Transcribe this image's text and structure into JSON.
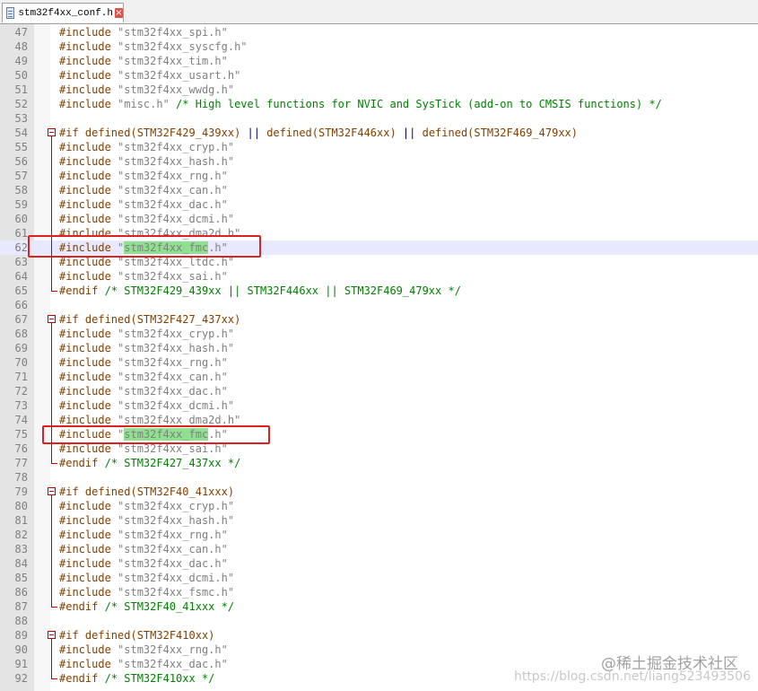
{
  "tab": {
    "filename": "stm32f4xx_conf.h",
    "icon": "header-file-icon",
    "close_symbol": "×"
  },
  "lines": [
    {
      "n": "47",
      "segs": [
        {
          "c": "pp",
          "t": "#include "
        },
        {
          "c": "str",
          "t": "\"stm32f4xx_spi.h\""
        }
      ]
    },
    {
      "n": "48",
      "segs": [
        {
          "c": "pp",
          "t": "#include "
        },
        {
          "c": "str",
          "t": "\"stm32f4xx_syscfg.h\""
        }
      ]
    },
    {
      "n": "49",
      "segs": [
        {
          "c": "pp",
          "t": "#include "
        },
        {
          "c": "str",
          "t": "\"stm32f4xx_tim.h\""
        }
      ]
    },
    {
      "n": "50",
      "segs": [
        {
          "c": "pp",
          "t": "#include "
        },
        {
          "c": "str",
          "t": "\"stm32f4xx_usart.h\""
        }
      ]
    },
    {
      "n": "51",
      "segs": [
        {
          "c": "pp",
          "t": "#include "
        },
        {
          "c": "str",
          "t": "\"stm32f4xx_wwdg.h\""
        }
      ]
    },
    {
      "n": "52",
      "segs": [
        {
          "c": "pp",
          "t": "#include "
        },
        {
          "c": "str",
          "t": "\"misc.h\""
        },
        {
          "c": "cmt",
          "t": " /* High level functions for NVIC and SysTick (add-on to CMSIS functions) */"
        }
      ]
    },
    {
      "n": "53",
      "segs": []
    },
    {
      "n": "54",
      "fold": "start",
      "segs": [
        {
          "c": "pp",
          "t": "#if defined(STM32F429_439xx) "
        },
        {
          "c": "op",
          "t": "||"
        },
        {
          "c": "pp",
          "t": " defined(STM32F446xx) "
        },
        {
          "c": "op",
          "t": "||"
        },
        {
          "c": "pp",
          "t": " defined(STM32F469_479xx)"
        }
      ]
    },
    {
      "n": "55",
      "segs": [
        {
          "c": "pp",
          "t": "#include "
        },
        {
          "c": "str",
          "t": "\"stm32f4xx_cryp.h\""
        }
      ]
    },
    {
      "n": "56",
      "segs": [
        {
          "c": "pp",
          "t": "#include "
        },
        {
          "c": "str",
          "t": "\"stm32f4xx_hash.h\""
        }
      ]
    },
    {
      "n": "57",
      "segs": [
        {
          "c": "pp",
          "t": "#include "
        },
        {
          "c": "str",
          "t": "\"stm32f4xx_rng.h\""
        }
      ]
    },
    {
      "n": "58",
      "segs": [
        {
          "c": "pp",
          "t": "#include "
        },
        {
          "c": "str",
          "t": "\"stm32f4xx_can.h\""
        }
      ]
    },
    {
      "n": "59",
      "segs": [
        {
          "c": "pp",
          "t": "#include "
        },
        {
          "c": "str",
          "t": "\"stm32f4xx_dac.h\""
        }
      ]
    },
    {
      "n": "60",
      "segs": [
        {
          "c": "pp",
          "t": "#include "
        },
        {
          "c": "str",
          "t": "\"stm32f4xx_dcmi.h\""
        }
      ]
    },
    {
      "n": "61",
      "segs": [
        {
          "c": "pp",
          "t": "#include "
        },
        {
          "c": "str",
          "t": "\"stm32f4xx_dma2d.h\""
        }
      ]
    },
    {
      "n": "62",
      "current": true,
      "segs": [
        {
          "c": "pp",
          "t": "#include "
        },
        {
          "c": "str",
          "t": "\""
        },
        {
          "c": "str hl",
          "t": "stm32f4xx_fmc"
        },
        {
          "c": "str",
          "t": ".h\""
        }
      ]
    },
    {
      "n": "63",
      "segs": [
        {
          "c": "pp",
          "t": "#include "
        },
        {
          "c": "str",
          "t": "\"stm32f4xx_ltdc.h\""
        }
      ]
    },
    {
      "n": "64",
      "segs": [
        {
          "c": "pp",
          "t": "#include "
        },
        {
          "c": "str",
          "t": "\"stm32f4xx_sai.h\""
        }
      ]
    },
    {
      "n": "65",
      "fold": "end",
      "segs": [
        {
          "c": "pp",
          "t": "#endif "
        },
        {
          "c": "cmt",
          "t": "/* STM32F429_439xx || STM32F446xx || STM32F469_479xx */"
        }
      ]
    },
    {
      "n": "66",
      "segs": []
    },
    {
      "n": "67",
      "fold": "start",
      "segs": [
        {
          "c": "pp",
          "t": "#if defined(STM32F427_437xx)"
        }
      ]
    },
    {
      "n": "68",
      "segs": [
        {
          "c": "pp",
          "t": "#include "
        },
        {
          "c": "str",
          "t": "\"stm32f4xx_cryp.h\""
        }
      ]
    },
    {
      "n": "69",
      "segs": [
        {
          "c": "pp",
          "t": "#include "
        },
        {
          "c": "str",
          "t": "\"stm32f4xx_hash.h\""
        }
      ]
    },
    {
      "n": "70",
      "segs": [
        {
          "c": "pp",
          "t": "#include "
        },
        {
          "c": "str",
          "t": "\"stm32f4xx_rng.h\""
        }
      ]
    },
    {
      "n": "71",
      "segs": [
        {
          "c": "pp",
          "t": "#include "
        },
        {
          "c": "str",
          "t": "\"stm32f4xx_can.h\""
        }
      ]
    },
    {
      "n": "72",
      "segs": [
        {
          "c": "pp",
          "t": "#include "
        },
        {
          "c": "str",
          "t": "\"stm32f4xx_dac.h\""
        }
      ]
    },
    {
      "n": "73",
      "segs": [
        {
          "c": "pp",
          "t": "#include "
        },
        {
          "c": "str",
          "t": "\"stm32f4xx_dcmi.h\""
        }
      ]
    },
    {
      "n": "74",
      "segs": [
        {
          "c": "pp",
          "t": "#include "
        },
        {
          "c": "str",
          "t": "\"stm32f4xx_dma2d.h\""
        }
      ]
    },
    {
      "n": "75",
      "segs": [
        {
          "c": "pp",
          "t": "#include "
        },
        {
          "c": "str",
          "t": "\""
        },
        {
          "c": "str hl",
          "t": "stm32f4xx_fmc"
        },
        {
          "c": "str",
          "t": ".h\""
        }
      ]
    },
    {
      "n": "76",
      "segs": [
        {
          "c": "pp",
          "t": "#include "
        },
        {
          "c": "str",
          "t": "\"stm32f4xx_sai.h\""
        }
      ]
    },
    {
      "n": "77",
      "fold": "end",
      "segs": [
        {
          "c": "pp",
          "t": "#endif "
        },
        {
          "c": "cmt",
          "t": "/* STM32F427_437xx */"
        }
      ]
    },
    {
      "n": "78",
      "segs": []
    },
    {
      "n": "79",
      "fold": "start",
      "segs": [
        {
          "c": "pp",
          "t": "#if defined(STM32F40_41xxx)"
        }
      ]
    },
    {
      "n": "80",
      "segs": [
        {
          "c": "pp",
          "t": "#include "
        },
        {
          "c": "str",
          "t": "\"stm32f4xx_cryp.h\""
        }
      ]
    },
    {
      "n": "81",
      "segs": [
        {
          "c": "pp",
          "t": "#include "
        },
        {
          "c": "str",
          "t": "\"stm32f4xx_hash.h\""
        }
      ]
    },
    {
      "n": "82",
      "segs": [
        {
          "c": "pp",
          "t": "#include "
        },
        {
          "c": "str",
          "t": "\"stm32f4xx_rng.h\""
        }
      ]
    },
    {
      "n": "83",
      "segs": [
        {
          "c": "pp",
          "t": "#include "
        },
        {
          "c": "str",
          "t": "\"stm32f4xx_can.h\""
        }
      ]
    },
    {
      "n": "84",
      "segs": [
        {
          "c": "pp",
          "t": "#include "
        },
        {
          "c": "str",
          "t": "\"stm32f4xx_dac.h\""
        }
      ]
    },
    {
      "n": "85",
      "segs": [
        {
          "c": "pp",
          "t": "#include "
        },
        {
          "c": "str",
          "t": "\"stm32f4xx_dcmi.h\""
        }
      ]
    },
    {
      "n": "86",
      "segs": [
        {
          "c": "pp",
          "t": "#include "
        },
        {
          "c": "str",
          "t": "\"stm32f4xx_fsmc.h\""
        }
      ]
    },
    {
      "n": "87",
      "fold": "end",
      "segs": [
        {
          "c": "pp",
          "t": "#endif "
        },
        {
          "c": "cmt",
          "t": "/* STM32F40_41xxx */"
        }
      ]
    },
    {
      "n": "88",
      "segs": []
    },
    {
      "n": "89",
      "fold": "start",
      "segs": [
        {
          "c": "pp",
          "t": "#if defined(STM32F410xx)"
        }
      ]
    },
    {
      "n": "90",
      "segs": [
        {
          "c": "pp",
          "t": "#include "
        },
        {
          "c": "str",
          "t": "\"stm32f4xx_rng.h\""
        }
      ]
    },
    {
      "n": "91",
      "segs": [
        {
          "c": "pp",
          "t": "#include "
        },
        {
          "c": "str",
          "t": "\"stm32f4xx_dac.h\""
        }
      ]
    },
    {
      "n": "92",
      "fold": "end",
      "segs": [
        {
          "c": "pp",
          "t": "#endif "
        },
        {
          "c": "cmt",
          "t": "/* STM32F410xx */"
        }
      ]
    }
  ],
  "watermark": {
    "text": "@稀土掘金技术社区",
    "url": "https://blog.csdn.net/liang523493506"
  },
  "colors": {
    "preprocessor": "#804000",
    "string": "#808080",
    "comment": "#008000",
    "highlight": "#8fe08f",
    "annotation_box": "#e02020"
  }
}
